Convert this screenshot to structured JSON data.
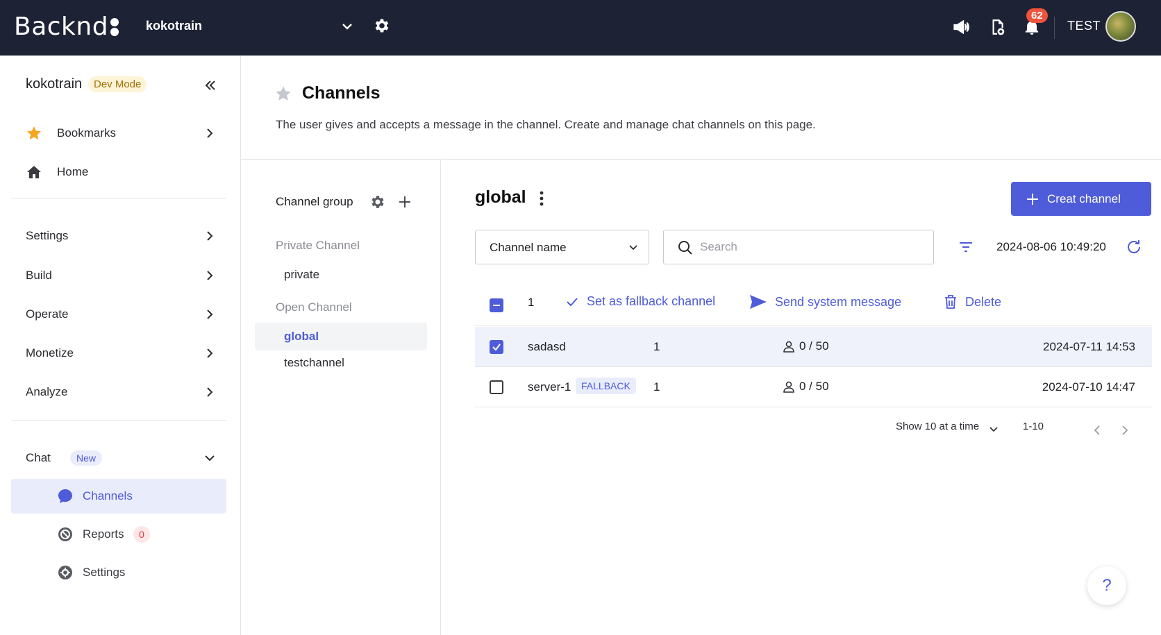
{
  "topbar": {
    "logo_text": "Backnd",
    "project": "kokotrain",
    "notification_count": "62",
    "user": "TEST"
  },
  "sidebar": {
    "project": "kokotrain",
    "mode_badge": "Dev Mode",
    "items_top": [
      {
        "label": "Bookmarks",
        "icon": "star-icon"
      },
      {
        "label": "Home",
        "icon": "home-icon"
      }
    ],
    "menu": [
      {
        "label": "Settings"
      },
      {
        "label": "Build"
      },
      {
        "label": "Operate"
      },
      {
        "label": "Monetize"
      },
      {
        "label": "Analyze"
      }
    ],
    "chat": {
      "label": "Chat",
      "badge": "New",
      "sub": [
        {
          "label": "Channels",
          "icon": "chat-bubble-icon"
        },
        {
          "label": "Reports",
          "icon": "report-icon",
          "badge": "0"
        },
        {
          "label": "Settings",
          "icon": "gear-icon"
        }
      ]
    }
  },
  "header": {
    "title": "Channels",
    "description": "The user gives and accepts a message in the channel. Create and manage chat channels on this page."
  },
  "groups": {
    "title": "Channel group",
    "private_label": "Private Channel",
    "private_items": [
      "private"
    ],
    "open_label": "Open Channel",
    "open_items": [
      "global",
      "testchannel"
    ]
  },
  "main": {
    "title": "global",
    "create_label": "Creat channel",
    "select_value": "Channel name",
    "search_placeholder": "Search",
    "timestamp": "2024-08-06 10:49:20",
    "selected_count": "1",
    "actions": {
      "fallback": "Set as fallback channel",
      "send": "Send system message",
      "delete": "Delete"
    },
    "rows": [
      {
        "name": "sadasd",
        "count": "1",
        "members": "0 / 50",
        "date": "2024-07-11 14:53",
        "checked": true
      },
      {
        "name": "server-1",
        "tag": "FALLBACK",
        "count": "1",
        "members": "0 / 50",
        "date": "2024-07-10 14:47",
        "checked": false
      }
    ],
    "pager": {
      "show_label": "Show 10 at a time",
      "range": "1-10"
    },
    "help": "?"
  },
  "colors": {
    "topbar_bg": "#1e2235",
    "accent": "#4e5cd9",
    "notification": "#f0533b",
    "dev_badge_bg": "#fdf3d6",
    "dev_badge_text": "#a07206"
  }
}
